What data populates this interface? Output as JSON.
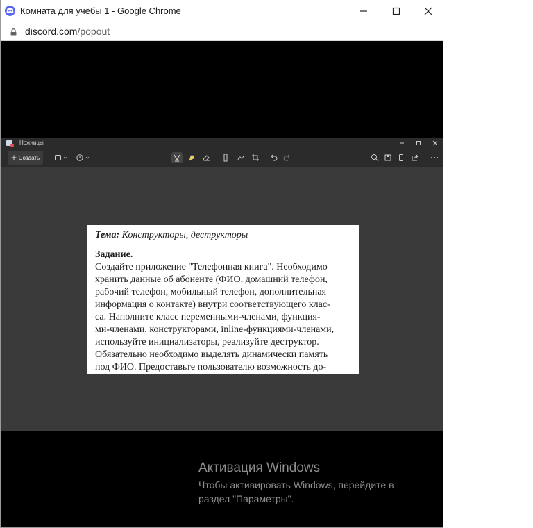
{
  "window": {
    "title": "Комната для учёбы 1 - Google Chrome",
    "url_domain": "discord.com",
    "url_path": "/popout"
  },
  "snipping_tool": {
    "title": "Ножницы",
    "new_button_label": "Создать",
    "icons": {
      "mode": "rectangle-mode-icon",
      "timer": "timer-icon",
      "pen": "ballpoint-pen-icon",
      "highlighter": "highlighter-icon",
      "eraser": "eraser-icon",
      "ruler": "ruler-icon",
      "touch": "touch-writing-icon",
      "crop": "crop-icon",
      "undo": "undo-icon",
      "redo": "redo-icon",
      "zoom": "zoom-icon",
      "save": "save-icon",
      "copy": "copy-icon",
      "share": "share-icon",
      "more": "more-icon"
    }
  },
  "document": {
    "topic_label": "Тема:",
    "topic_text": "Конструкторы, деструкторы",
    "task_label": "Задание.",
    "lines": [
      "Создайте приложение \"Телефонная книга\". Необходимо",
      "хранить данные об абоненте (ФИО, домашний телефон,",
      "рабочий телефон, мобильный телефон, дополнительная",
      "информация о контакте) внутри соответствующего клас-",
      "са. Наполните класс переменными-членами, функция-",
      "ми-членами, конструкторами, inline-функциями-членами,",
      "используйте инициализаторы, реализуйте деструктор.",
      "Обязательно необходимо выделять динамически память",
      "под ФИО. Предоставьте пользователю возможность до-"
    ]
  },
  "activation": {
    "title": "Активация Windows",
    "text": "Чтобы активировать Windows, перейдите в раздел \"Параметры\"."
  }
}
